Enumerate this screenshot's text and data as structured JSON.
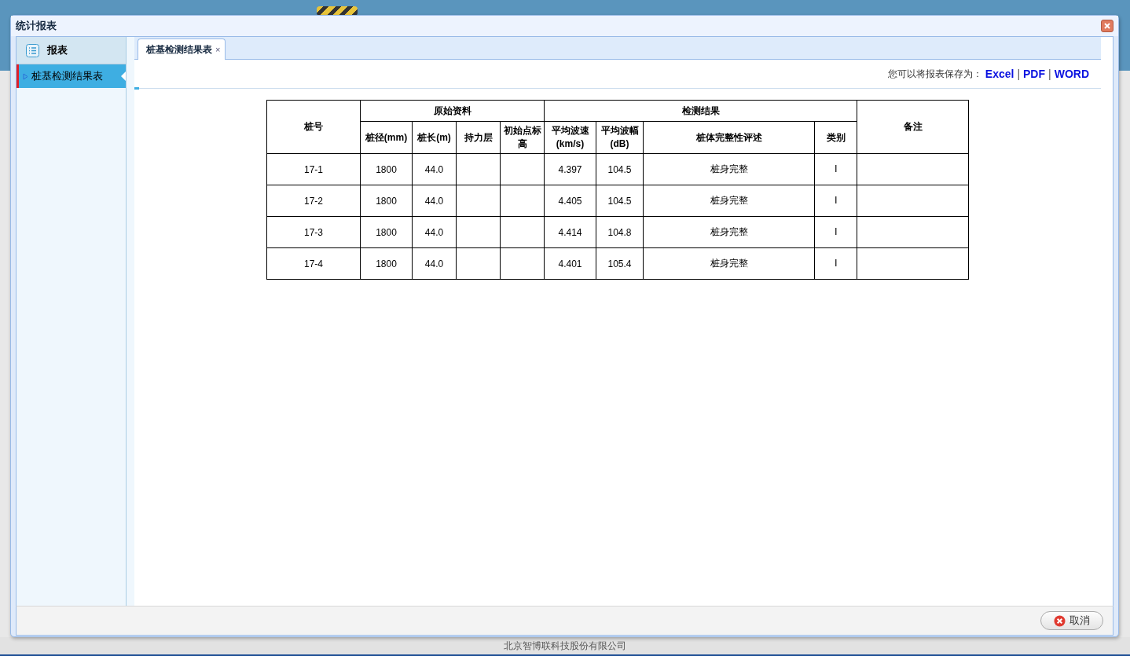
{
  "window": {
    "title": "统计报表"
  },
  "sidebar": {
    "header": "报表",
    "items": [
      {
        "label": "桩基检测结果表",
        "selected": true
      }
    ]
  },
  "tabs": [
    {
      "label": "桩基检测结果表",
      "selected": true,
      "close": "×"
    }
  ],
  "export": {
    "prompt": "您可以将报表保存为：",
    "items": [
      {
        "kind": "link",
        "text": "Excel"
      },
      {
        "kind": "separator",
        "text": "|"
      },
      {
        "kind": "link",
        "text": "PDF"
      },
      {
        "kind": "separator",
        "text": "|"
      },
      {
        "kind": "link",
        "text": "WORD"
      }
    ]
  },
  "table": {
    "header": [
      {
        "label": "桩号"
      },
      {
        "label": "原始资料",
        "children": [
          "桩径(mm)",
          "桩长(m)",
          "持力层",
          "初始点标高"
        ]
      },
      {
        "label": "检测结果",
        "children": [
          "平均波速(km/s)",
          "平均波幅(dB)",
          "桩体完整性评述",
          "类别"
        ]
      },
      {
        "label": "备注"
      }
    ],
    "rows": [
      [
        "17-1",
        "1800",
        "44.0",
        null,
        null,
        "4.397",
        "104.5",
        "桩身完整",
        "Ⅰ",
        null
      ],
      [
        "17-2",
        "1800",
        "44.0",
        null,
        null,
        "4.405",
        "104.5",
        "桩身完整",
        "Ⅰ",
        null
      ],
      [
        "17-3",
        "1800",
        "44.0",
        null,
        null,
        "4.414",
        "104.8",
        "桩身完整",
        "Ⅰ",
        null
      ],
      [
        "17-4",
        "1800",
        "44.0",
        null,
        null,
        "4.401",
        "105.4",
        "桩身完整",
        "Ⅰ",
        null
      ]
    ]
  },
  "buttons": [
    {
      "kind": "cancel",
      "label": "取消"
    }
  ],
  "status_bar": {
    "text": "北京智博联科技股份有限公司"
  }
}
